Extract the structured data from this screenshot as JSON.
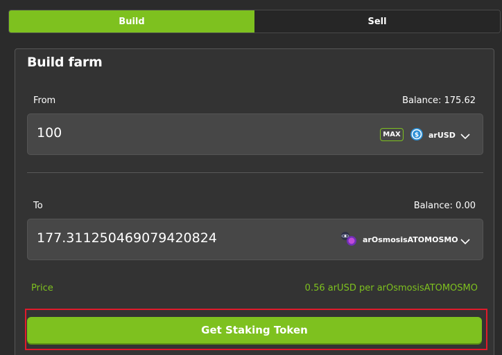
{
  "tabs": {
    "build": "Build",
    "sell": "Sell"
  },
  "card": {
    "title": "Build farm",
    "from": {
      "label": "From",
      "balance": "Balance: 175.62",
      "amount": "100",
      "max_label": "MAX",
      "token": "arUSD",
      "token_icon": "usd-coin-icon"
    },
    "to": {
      "label": "To",
      "balance": "Balance: 0.00",
      "amount": "177.311250469079420824",
      "token": "arOsmosisATOMOSMO",
      "token_icon": "atom-osmo-pair-icon"
    },
    "price": {
      "label": "Price",
      "value": "0.56 arUSD per arOsmosisATOMOSMO"
    },
    "cta_label": "Get Staking Token"
  },
  "colors": {
    "accent": "#7ec11f",
    "highlight": "#e01a2b",
    "panel": "#333333",
    "input": "#474747"
  }
}
